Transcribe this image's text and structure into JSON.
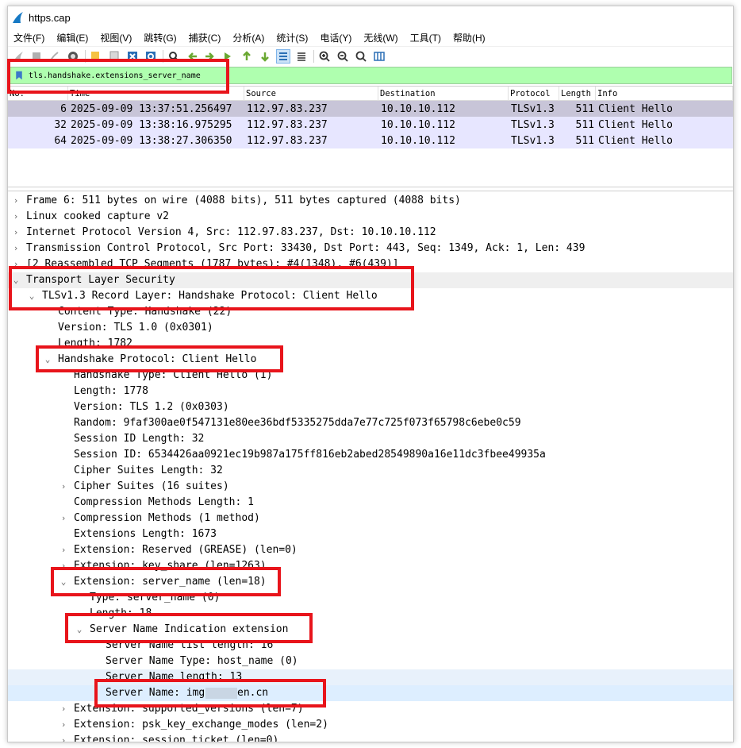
{
  "window": {
    "title": "https.cap"
  },
  "menu": [
    "文件(F)",
    "编辑(E)",
    "视图(V)",
    "跳转(G)",
    "捕获(C)",
    "分析(A)",
    "统计(S)",
    "电话(Y)",
    "无线(W)",
    "工具(T)",
    "帮助(H)"
  ],
  "filter": {
    "value": "tls.handshake.extensions_server_name"
  },
  "packet_list": {
    "columns": {
      "no": "No.",
      "time": "Time",
      "source": "Source",
      "destination": "Destination",
      "protocol": "Protocol",
      "length": "Length",
      "info": "Info"
    },
    "rows": [
      {
        "no": "6",
        "time": "2025-09-09 13:37:51.256497",
        "source": "112.97.83.237",
        "destination": "10.10.10.112",
        "protocol": "TLSv1.3",
        "length": "511",
        "info": "Client Hello"
      },
      {
        "no": "32",
        "time": "2025-09-09 13:38:16.975295",
        "source": "112.97.83.237",
        "destination": "10.10.10.112",
        "protocol": "TLSv1.3",
        "length": "511",
        "info": "Client Hello"
      },
      {
        "no": "64",
        "time": "2025-09-09 13:38:27.306350",
        "source": "112.97.83.237",
        "destination": "10.10.10.112",
        "protocol": "TLSv1.3",
        "length": "511",
        "info": "Client Hello"
      }
    ]
  },
  "details": [
    "Frame 6: 511 bytes on wire (4088 bits), 511 bytes captured (4088 bits)",
    "Linux cooked capture v2",
    "Internet Protocol Version 4, Src: 112.97.83.237, Dst: 10.10.10.112",
    "Transmission Control Protocol, Src Port: 33430, Dst Port: 443, Seq: 1349, Ack: 1, Len: 439",
    "[2 Reassembled TCP Segments (1787 bytes): #4(1348), #6(439)]",
    "Transport Layer Security",
    "TLSv1.3 Record Layer: Handshake Protocol: Client Hello",
    "Content Type: Handshake (22)",
    "Version: TLS 1.0 (0x0301)",
    "Length: 1782",
    "Handshake Protocol: Client Hello",
    "Handshake Type: Client Hello (1)",
    "Length: 1778",
    "Version: TLS 1.2 (0x0303)",
    "Random: 9faf300ae0f547131e80ee36bdf5335275dda7e77c725f073f65798c6ebe0c59",
    "Session ID Length: 32",
    "Session ID: 6534426aa0921ec19b987a175ff816eb2abed28549890a16e11dc3fbee49935a",
    "Cipher Suites Length: 32",
    "Cipher Suites (16 suites)",
    "Compression Methods Length: 1",
    "Compression Methods (1 method)",
    "Extensions Length: 1673",
    "Extension: Reserved (GREASE) (len=0)",
    "Extension: key_share (len=1263)",
    "Extension: server_name (len=18)",
    "Type: server_name (0)",
    "Length: 18",
    "Server Name Indication extension",
    "Server Name list length: 16",
    "Server Name Type: host_name (0)",
    "Server Name length: 13",
    "Server Name: img.",
    "en.cn",
    "Extension: supported_versions (len=7)",
    "Extension: psk_key_exchange_modes (len=2)",
    "Extension: session_ticket (len=0)"
  ],
  "colors": {
    "annotation_red": "#e8141b",
    "filter_green": "#afffaf",
    "row_lavender": "#e7e6ff",
    "row_selected": "#c8c5d8"
  }
}
